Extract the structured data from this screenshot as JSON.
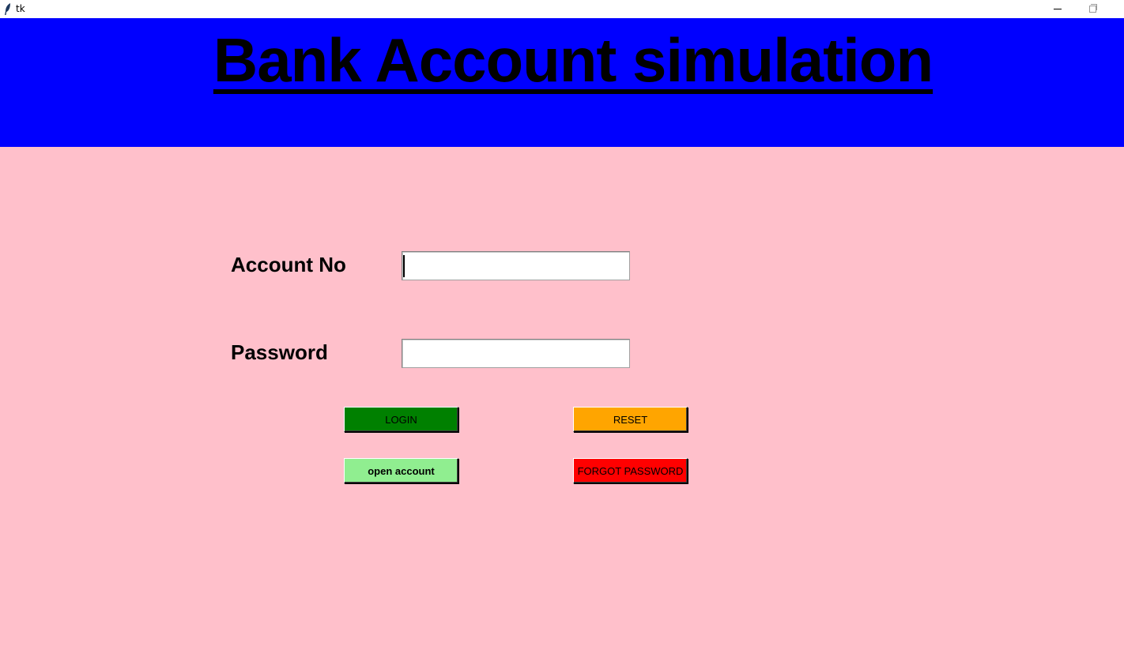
{
  "window": {
    "title": "tk",
    "app_icon": "feather-icon",
    "controls": [
      "minimize-icon",
      "maximize-icon",
      "close-icon"
    ]
  },
  "header": {
    "title": "Bank Account simulation",
    "background": "#0000ff"
  },
  "form": {
    "account_label": "Account No",
    "account_value": "",
    "password_label": "Password",
    "password_value": ""
  },
  "buttons": {
    "login": {
      "label": "LOGIN",
      "color": "#008000"
    },
    "reset": {
      "label": "RESET",
      "color": "#ffa500"
    },
    "open_account": {
      "label": "open account",
      "color": "#90ee90"
    },
    "forgot_password": {
      "label": "FORGOT PASSWORD",
      "color": "#ff0000"
    }
  },
  "page": {
    "background": "#ffc0cb"
  }
}
